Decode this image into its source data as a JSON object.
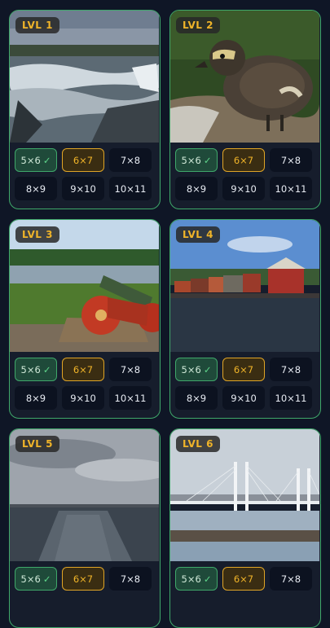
{
  "colors": {
    "background": "#0f1626",
    "card_border": "#3fa86a",
    "level_badge": "#f0b429",
    "selected": "#e0a526"
  },
  "levels": [
    {
      "badge": "LVL 1",
      "image": "waterfall-landscape",
      "options": [
        {
          "label": "5×6",
          "state": "done"
        },
        {
          "label": "6×7",
          "state": "active"
        },
        {
          "label": "7×8",
          "state": "idle"
        },
        {
          "label": "8×9",
          "state": "idle"
        },
        {
          "label": "9×10",
          "state": "idle"
        },
        {
          "label": "10×11",
          "state": "idle"
        }
      ]
    },
    {
      "badge": "LVL 2",
      "image": "duckling",
      "options": [
        {
          "label": "5×6",
          "state": "done"
        },
        {
          "label": "6×7",
          "state": "active"
        },
        {
          "label": "7×8",
          "state": "idle"
        },
        {
          "label": "8×9",
          "state": "idle"
        },
        {
          "label": "9×10",
          "state": "idle"
        },
        {
          "label": "10×11",
          "state": "idle"
        }
      ]
    },
    {
      "badge": "LVL 3",
      "image": "red-cannon",
      "options": [
        {
          "label": "5×6",
          "state": "done"
        },
        {
          "label": "6×7",
          "state": "active"
        },
        {
          "label": "7×8",
          "state": "idle"
        },
        {
          "label": "8×9",
          "state": "idle"
        },
        {
          "label": "9×10",
          "state": "idle"
        },
        {
          "label": "10×11",
          "state": "idle"
        }
      ]
    },
    {
      "badge": "LVL 4",
      "image": "riverside-houses",
      "options": [
        {
          "label": "5×6",
          "state": "done"
        },
        {
          "label": "6×7",
          "state": "active"
        },
        {
          "label": "7×8",
          "state": "idle"
        },
        {
          "label": "8×9",
          "state": "idle"
        },
        {
          "label": "9×10",
          "state": "idle"
        },
        {
          "label": "10×11",
          "state": "idle"
        }
      ]
    },
    {
      "badge": "LVL 5",
      "image": "ship-wake-sea",
      "options": [
        {
          "label": "5×6",
          "state": "done"
        },
        {
          "label": "6×7",
          "state": "active"
        },
        {
          "label": "7×8",
          "state": "idle"
        }
      ]
    },
    {
      "badge": "LVL 6",
      "image": "cable-stayed-bridge",
      "options": [
        {
          "label": "5×6",
          "state": "done"
        },
        {
          "label": "6×7",
          "state": "active"
        },
        {
          "label": "7×8",
          "state": "idle"
        }
      ]
    }
  ],
  "check_glyph": "✓"
}
